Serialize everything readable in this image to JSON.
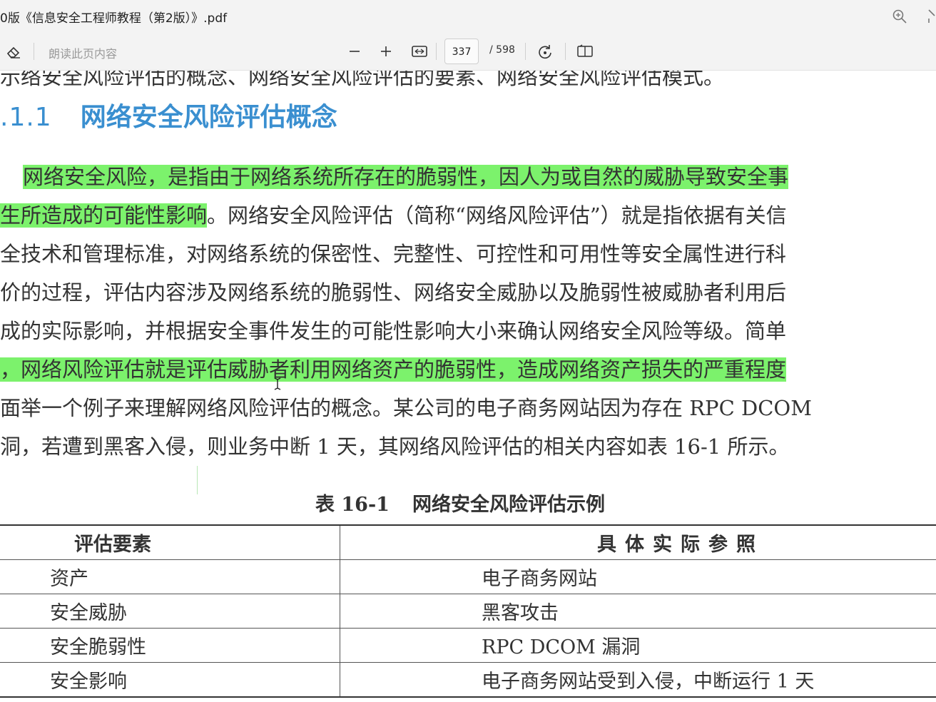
{
  "window": {
    "title": "0版《信息安全工程师教程（第2版）》.pdf"
  },
  "toolbar": {
    "read_aloud": "朗读此页内容",
    "current_page": "337",
    "total_pages": "/ 598",
    "icons": [
      "eraser-icon",
      "zoom-out-icon",
      "zoom-in-icon",
      "fit-width-icon",
      "rotate-icon",
      "page-view-icon",
      "search-icon"
    ]
  },
  "document": {
    "cut_top_line": "示络安全风险评估的概念、网络安全风险评估的要素、网络安全风险评估模式。",
    "heading_number": ".1.1",
    "heading_text": "网络安全风险评估概念",
    "paragraph": [
      {
        "pre": "  ",
        "hl": "网络安全风险，是指由于网络系统所存在的脆弱性，因人为或自然的威胁导致安全事",
        "post": ""
      },
      {
        "pre": "",
        "hl": "生所造成的可能性影响",
        "post": "。网络安全风险评估（简称“网络风险评估”）就是指依据有关信"
      },
      {
        "pre": "",
        "hl": "",
        "post": "全技术和管理标准，对网络系统的保密性、完整性、可控性和可用性等安全属性进行科"
      },
      {
        "pre": "",
        "hl": "",
        "post": "价的过程，评估内容涉及网络系统的脆弱性、网络安全威胁以及脆弱性被威胁者利用后"
      },
      {
        "pre": "",
        "hl": "",
        "post": "成的实际影响，并根据安全事件发生的可能性影响大小来确认网络安全风险等级。简单"
      },
      {
        "pre": "",
        "hl": "，网络风险评估就是评估威胁者利用网络资产的脆弱性，造成网络资产损失的严重程度",
        "post": ""
      },
      {
        "pre": "",
        "hl": "",
        "post": "面举一个例子来理解网络风险评估的概念。某公司的电子商务网站因为存在 RPC  DCOM"
      },
      {
        "pre": "",
        "hl": "",
        "post": "洞，若遭到黑客入侵，则业务中断 1 天，其网络风险评估的相关内容如表 16-1 所示。"
      }
    ],
    "table_caption_num": "表 16-1",
    "table_caption_text": "网络安全风险评估示例",
    "table": {
      "headers": [
        "评估要素",
        "具体实际参照"
      ],
      "rows": [
        [
          "资产",
          "电子商务网站"
        ],
        [
          "安全威胁",
          "黑客攻击"
        ],
        [
          "安全脆弱性",
          "RPC DCOM 漏洞"
        ],
        [
          "安全影响",
          "电子商务网站受到入侵，中断运行 1 天"
        ]
      ]
    }
  },
  "colors": {
    "highlight": "#7cf26c",
    "heading": "#3a8fd0",
    "toolbar_bg": "#f3f3f3"
  }
}
